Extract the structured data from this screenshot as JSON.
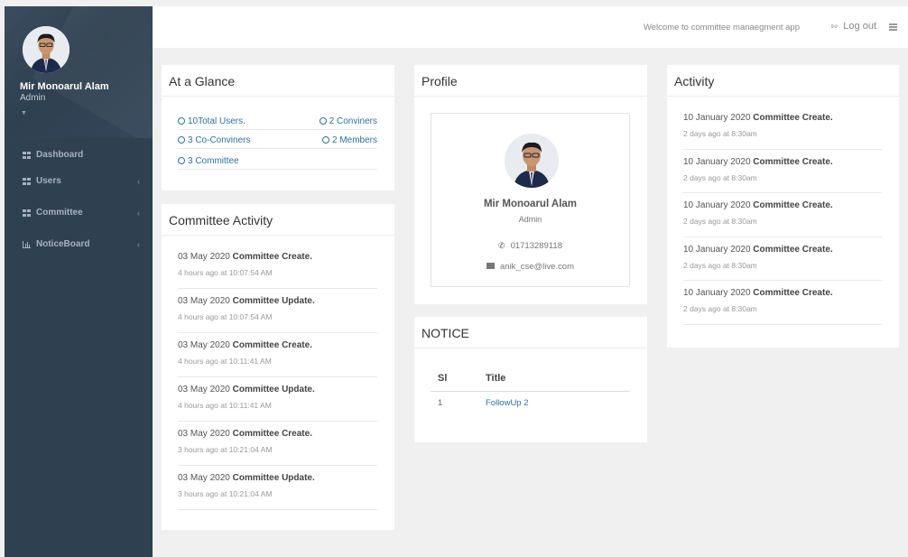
{
  "user": {
    "name": "Mir Monoarul Alam",
    "role": "Admin"
  },
  "sidebar": {
    "caret": "▼",
    "items": [
      {
        "label": "Dashboard",
        "icon": "grid-icon",
        "has_arrow": false
      },
      {
        "label": "Users",
        "icon": "grid-icon",
        "has_arrow": true
      },
      {
        "label": "Committee",
        "icon": "grid-icon",
        "has_arrow": true
      },
      {
        "label": "NoticeBoard",
        "icon": "bar-chart-icon",
        "has_arrow": true
      }
    ],
    "arrow": "‹"
  },
  "topbar": {
    "welcome": "Welcome to committee manaegment app",
    "logout": "Log out",
    "logout_icon": "⇰"
  },
  "glance": {
    "title": "At a Glance",
    "rows": [
      {
        "left": "10Total Users.",
        "right": "2 Conviners"
      },
      {
        "left": "3 Co-Conviners",
        "right": "2 Members"
      },
      {
        "left": "3 Committee",
        "right": ""
      }
    ]
  },
  "committee_activity": {
    "title": "Committee Activity",
    "items": [
      {
        "date": "03 May 2020",
        "action": "Committee Create.",
        "time": "4 hours ago at 10:07:54 AM"
      },
      {
        "date": "03 May 2020",
        "action": "Committee Update.",
        "time": "4 hours ago at 10:07:54 AM"
      },
      {
        "date": "03 May 2020",
        "action": "Committee Create.",
        "time": "4 hours ago at 10:11:41 AM"
      },
      {
        "date": "03 May 2020",
        "action": "Committee Update.",
        "time": "4 hours ago at 10:11:41 AM"
      },
      {
        "date": "03 May 2020",
        "action": "Committee Create.",
        "time": "3 hours ago at 10:21:04 AM"
      },
      {
        "date": "03 May 2020",
        "action": "Committee Update.",
        "time": "3 hours ago at 10:21:04 AM"
      }
    ]
  },
  "profile": {
    "title": "Profile",
    "name": "Mir Monoarul Alam",
    "role": "Admin",
    "phone": "01713289118",
    "email": "anik_cse@live.com",
    "phone_icon": "✆"
  },
  "notice": {
    "title": "NOTICE",
    "columns": [
      "Sl",
      "Title"
    ],
    "rows": [
      {
        "sl": "1",
        "title": "FollowUp 2"
      }
    ]
  },
  "activity": {
    "title": "Activity",
    "items": [
      {
        "date": "10 January 2020",
        "action": "Committee Create.",
        "time": "2 days ago at 8:30am"
      },
      {
        "date": "10 January 2020",
        "action": "Committee Create.",
        "time": "2 days ago at 8:30am"
      },
      {
        "date": "10 January 2020",
        "action": "Committee Create.",
        "time": "2 days ago at 8:30am"
      },
      {
        "date": "10 January 2020",
        "action": "Committee Create.",
        "time": "2 days ago at 8:30am"
      },
      {
        "date": "10 January 2020",
        "action": "Committee Create.",
        "time": "2 days ago at 8:30am"
      }
    ]
  }
}
